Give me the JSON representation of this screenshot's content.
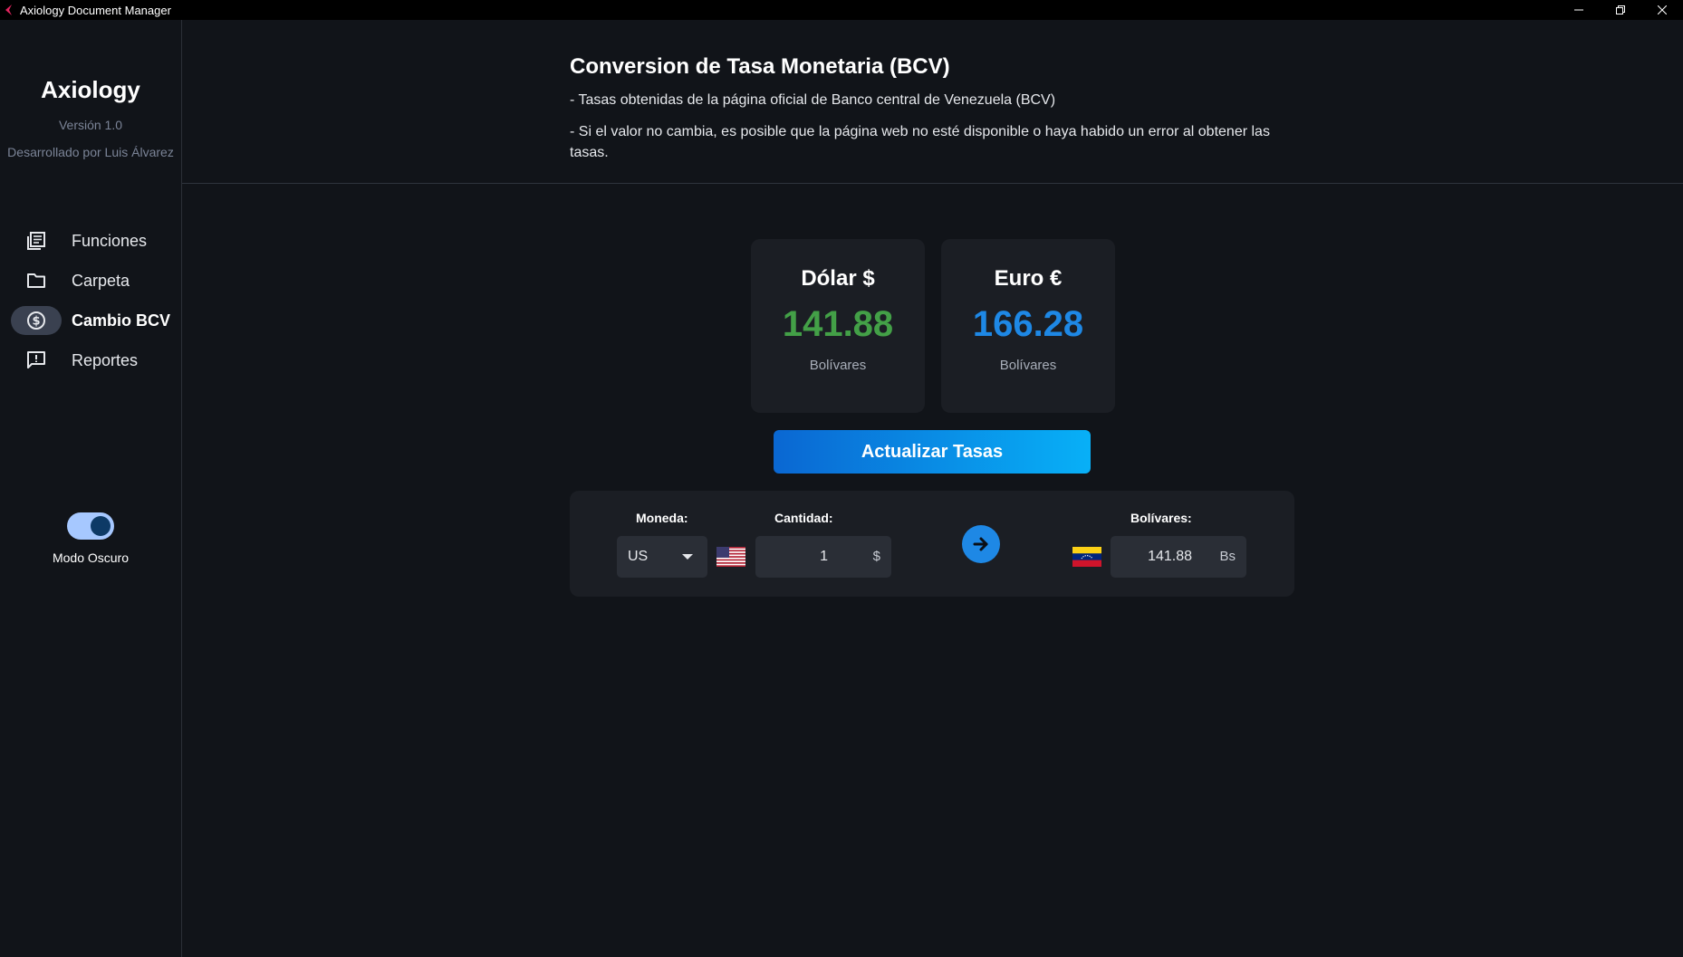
{
  "window": {
    "title": "Axiology Document Manager",
    "controls": [
      "minimize-icon",
      "restore-icon",
      "close-icon"
    ]
  },
  "sidebar": {
    "brand": "Axiology",
    "version": "Versión 1.0",
    "author": "Desarrollado por Luis Álvarez",
    "items": [
      {
        "label": "Funciones",
        "icon": "document-list-icon",
        "active": false
      },
      {
        "label": "Carpeta",
        "icon": "folder-icon",
        "active": false
      },
      {
        "label": "Cambio BCV",
        "icon": "dollar-circle-icon",
        "active": true
      },
      {
        "label": "Reportes",
        "icon": "report-icon",
        "active": false
      }
    ],
    "dark_mode": {
      "label": "Modo Oscuro",
      "enabled": true
    }
  },
  "header": {
    "title": "Conversion de Tasa Monetaria (BCV)",
    "line1": "- Tasas obtenidas de la página oficial de Banco central de Venezuela (BCV)",
    "line2": "- Si el valor no cambia, es posible que la página web no esté disponible o haya habido un error al obtener las tasas."
  },
  "rates": {
    "dollar": {
      "name": "Dólar $",
      "value": "141.88",
      "unit": "Bolívares",
      "color": "#43a047"
    },
    "euro": {
      "name": "Euro €",
      "value": "166.28",
      "unit": "Bolívares",
      "color": "#1e88e5"
    }
  },
  "update_button": "Actualizar Tasas",
  "converter": {
    "currency_label": "Moneda:",
    "currency_value": "US",
    "quantity_label": "Cantidad:",
    "quantity_value": "1",
    "quantity_symbol": "$",
    "result_label": "Bolívares:",
    "result_value": "141.88",
    "result_symbol": "Bs",
    "flags": [
      "us-flag-icon",
      "venezuela-flag-icon"
    ]
  },
  "colors": {
    "accent": "#1e88e5",
    "background": "#111419",
    "card": "#1b1e24"
  }
}
